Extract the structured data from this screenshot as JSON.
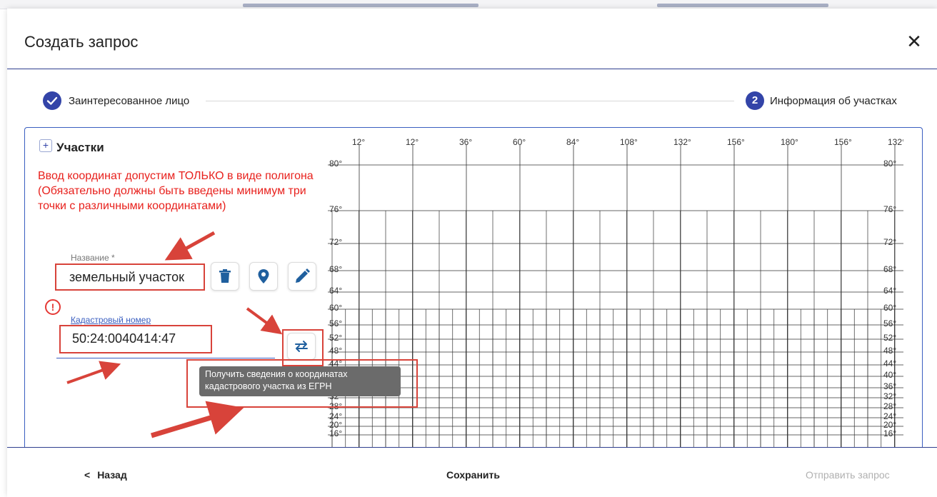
{
  "modal": {
    "title": "Создать запрос",
    "close_icon": "close-icon"
  },
  "stepper": {
    "step1": {
      "label": "Заинтересованное лицо",
      "state": "done",
      "icon": "check-icon"
    },
    "step2": {
      "number": "2",
      "label": "Информация об участках",
      "state": "active"
    }
  },
  "section": {
    "title": "Участки",
    "expand_icon": "plus-icon"
  },
  "warning": {
    "text": "Ввод координат допустим ТОЛЬКО в виде полигона (Обязательно должны быть введены минимум три точки с различными координатами)",
    "color": "#e8211d"
  },
  "name_field": {
    "label": "Название *",
    "value": "земельный участок"
  },
  "name_actions": [
    {
      "name": "delete",
      "icon": "trash-icon"
    },
    {
      "name": "location",
      "icon": "map-pin-icon"
    },
    {
      "name": "edit",
      "icon": "pencil-icon"
    }
  ],
  "cadastral_field": {
    "label": "Кадастровый номер",
    "value": "50:24:0040414:47",
    "error_icon": "exclamation-icon"
  },
  "swap_button": {
    "icon": "swap-arrows-icon"
  },
  "tooltip": {
    "text": "Получить сведения о координатах кадастрового участка из ЕГРН"
  },
  "map": {
    "top_labels": [
      "12°",
      "12°",
      "36°",
      "60°",
      "84°",
      "108°",
      "132°",
      "156°",
      "180°",
      "156°",
      "132°"
    ],
    "lat_labels": [
      "80°",
      "76°",
      "72°",
      "68°",
      "64°",
      "60°",
      "56°",
      "52°",
      "48°",
      "44°",
      "40°",
      "36°",
      "32°",
      "28°",
      "24°",
      "20°",
      "16°"
    ]
  },
  "footer": {
    "back_label": "Назад",
    "back_icon": "chevron-left-icon",
    "save_label": "Сохранить",
    "send_label": "Отправить запрос"
  },
  "colors": {
    "accent": "#3344a8",
    "highlight": "#d8433a",
    "disabled": "#b0b0b0"
  }
}
